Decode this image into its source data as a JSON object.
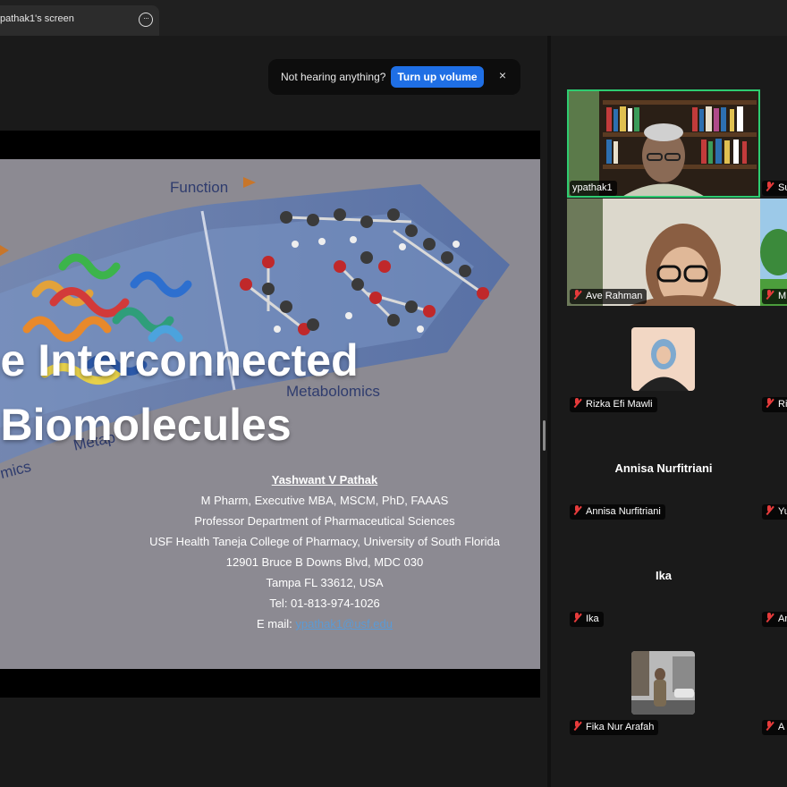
{
  "tab": {
    "title": "pathak1's screen",
    "more_icon": "ellipsis-icon"
  },
  "toast": {
    "message": "Not hearing anything?",
    "button": "Turn up volume",
    "close": "×"
  },
  "slide": {
    "title_line1": "he Interconnected",
    "title_line2": "f Biomolecules",
    "label_function": "Function",
    "label_metabolomics": "Metabolomics",
    "label_metap": "Metap",
    "label_mics": "mics",
    "author_name": "Yashwant V Pathak",
    "author_lines": [
      "M Pharm, Executive MBA, MSCM, PhD, FAAAS",
      "Professor  Department of Pharmaceutical Sciences",
      "USF Health Taneja College of Pharmacy, University of South Florida",
      "12901 Bruce B Downs Blvd, MDC 030",
      "Tampa FL 33612, USA",
      "Tel: 01-813-974-1026"
    ],
    "email_label": "E mail: ",
    "email": "ypathak1@usf.edu"
  },
  "participants": [
    {
      "name": "ypathak1",
      "speaking": true
    },
    {
      "name": "Su"
    },
    {
      "name": "Ave Rahman"
    },
    {
      "name": "M"
    },
    {
      "name": "Rizka Efi Mawli"
    },
    {
      "name": "Ri"
    },
    {
      "name": "Annisa Nurfitriani",
      "display": "Annisa Nurfitriani"
    },
    {
      "name": "Yu"
    },
    {
      "name": "Ika",
      "display": "Ika"
    },
    {
      "name": "An"
    },
    {
      "name": "Fika Nur Arafah"
    },
    {
      "name": "A"
    }
  ],
  "colors": {
    "speaking_border": "#2ecc71",
    "toast_button": "#1f6fe5",
    "muted_mic": "#e53b3b"
  }
}
